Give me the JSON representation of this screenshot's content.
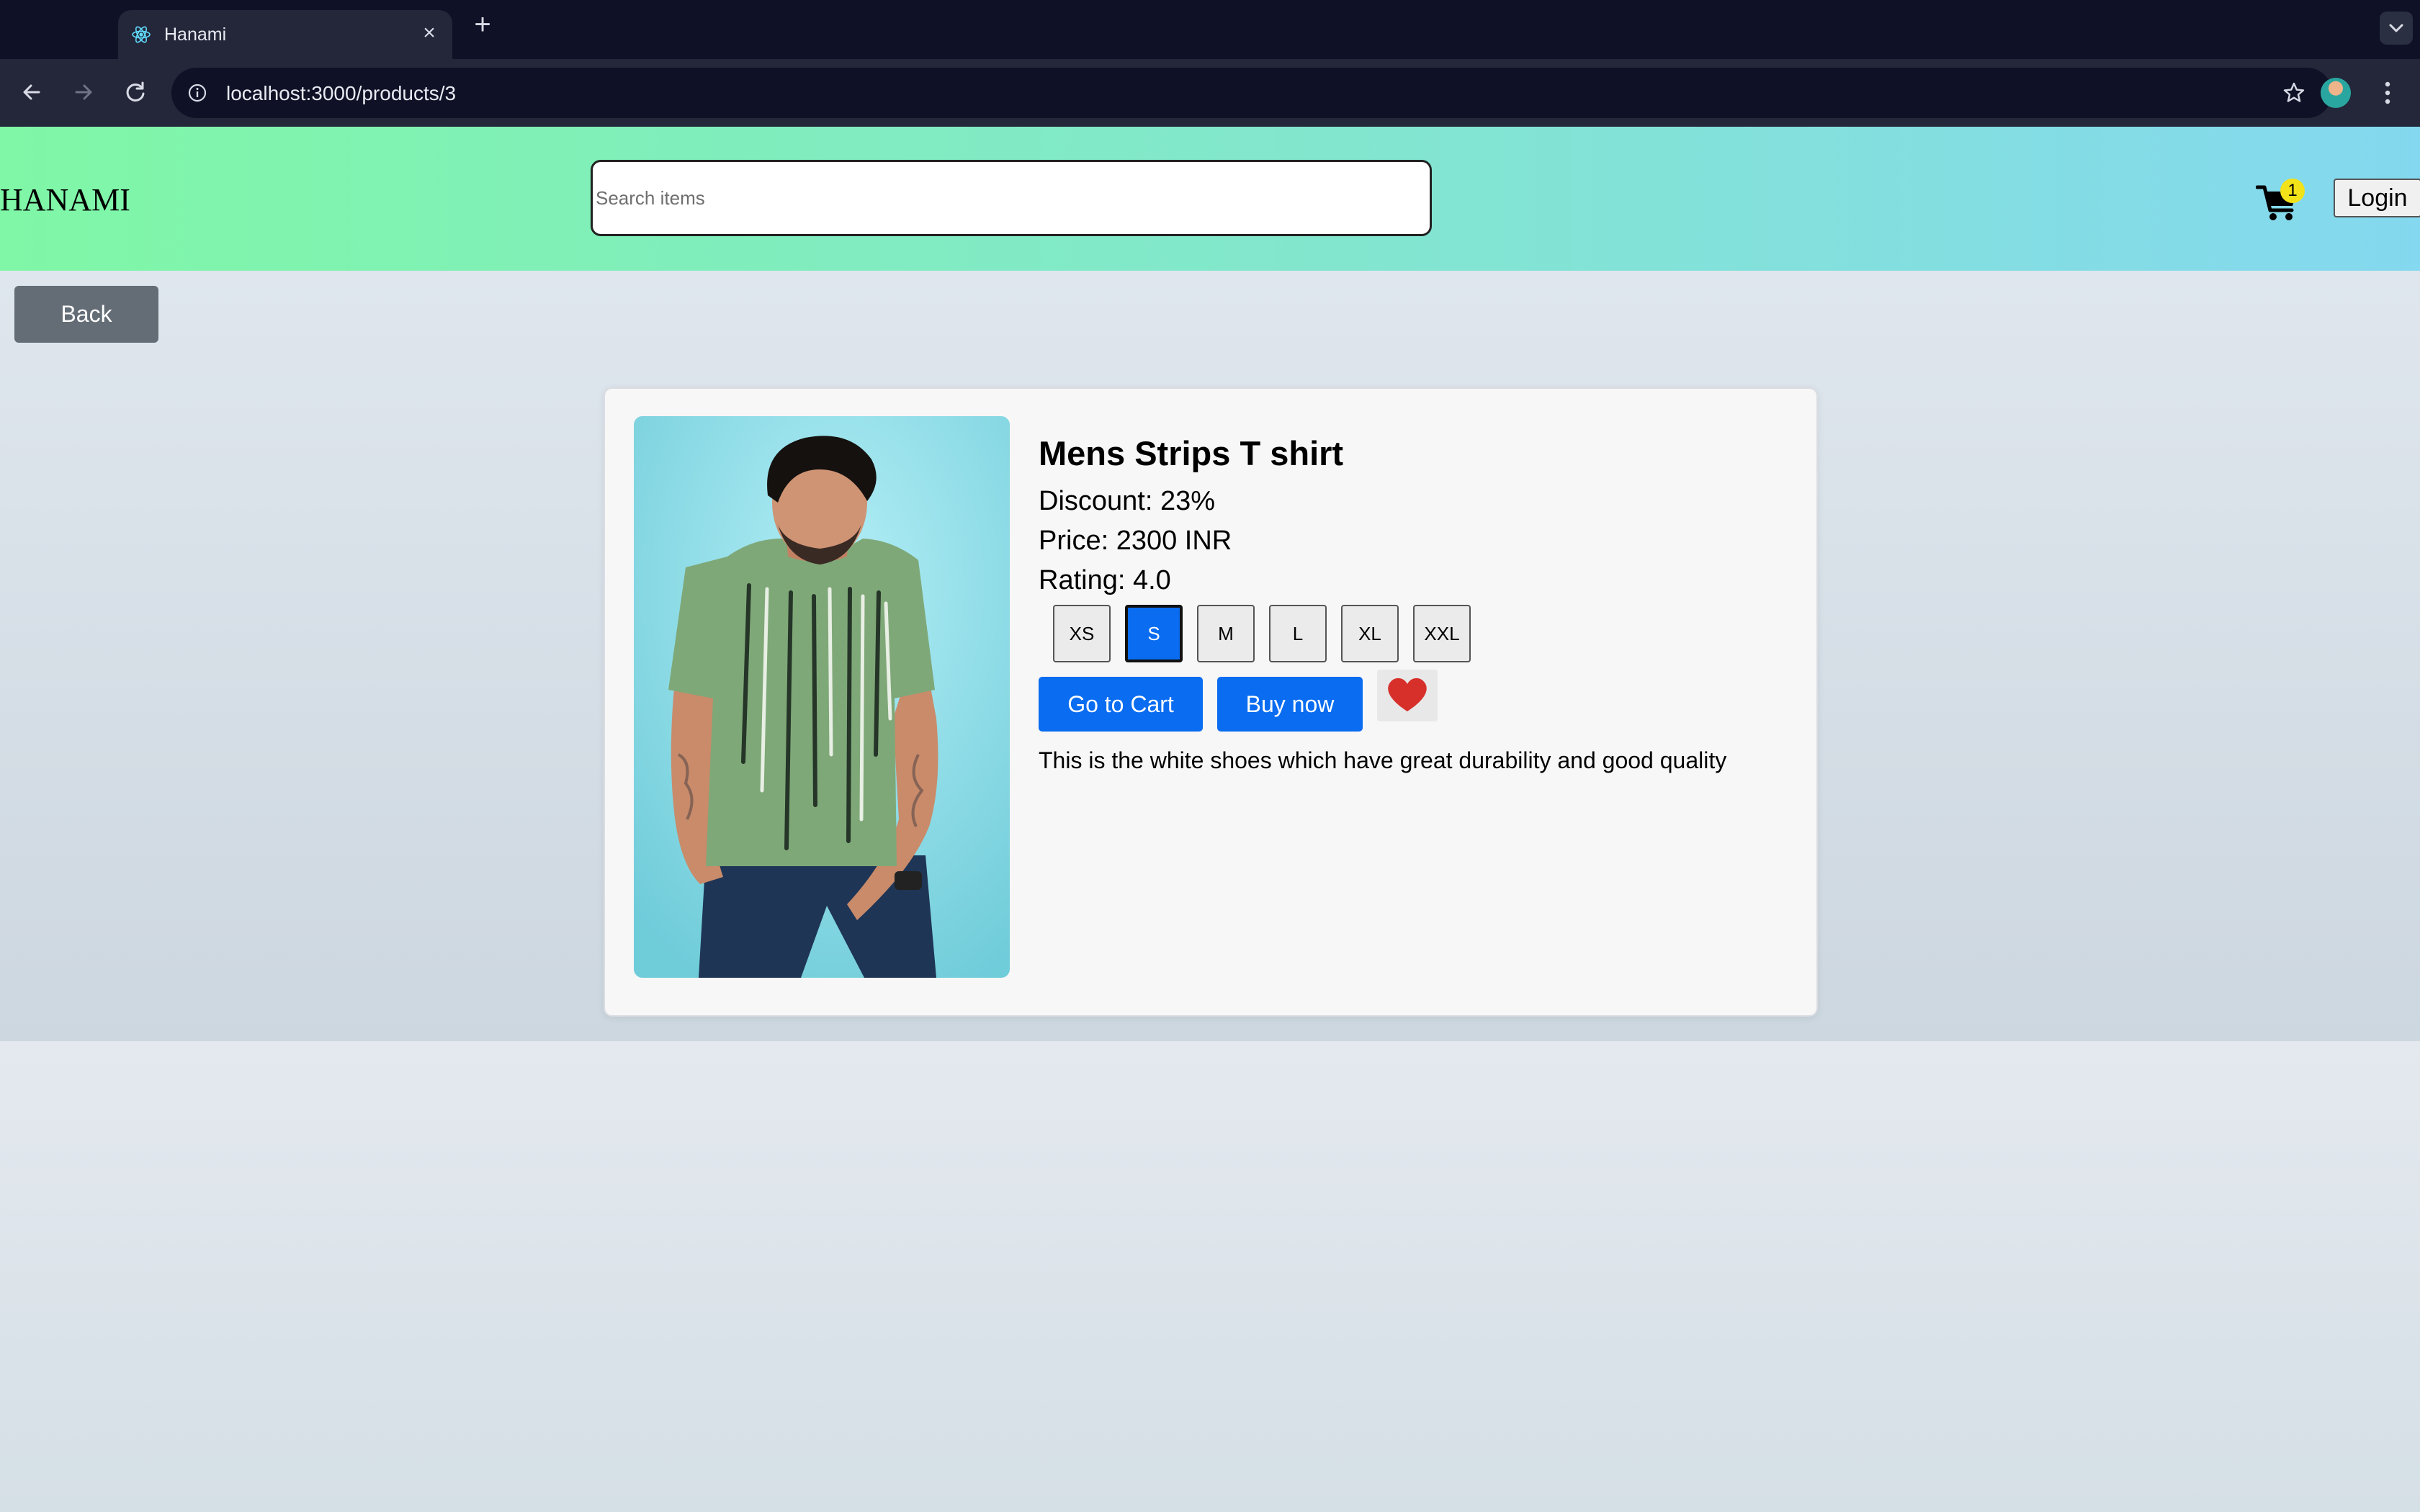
{
  "browser": {
    "tab_title": "Hanami",
    "new_tab_symbol": "+",
    "close_symbol": "×",
    "url": "localhost:3000/products/3"
  },
  "header": {
    "brand": "HANAMI",
    "search_placeholder": "Search items",
    "cart_count": "1",
    "login_label": "Login",
    "gradient_start": "#7ff7a6",
    "gradient_end": "#84d8ef"
  },
  "nav": {
    "back_label": "Back"
  },
  "product": {
    "title": "Mens Strips T shirt",
    "discount_text": "Discount: 23%",
    "price_text": "Price: 2300 INR",
    "rating_text": "Rating: 4.0",
    "sizes": [
      "XS",
      "S",
      "M",
      "L",
      "XL",
      "XXL"
    ],
    "selected_size": "S",
    "go_to_cart_label": "Go to Cart",
    "buy_now_label": "Buy now",
    "description": "This is the white shoes which have great durability and good quality"
  },
  "colors": {
    "accent": "#0a6cf0",
    "heart": "#d7302a",
    "back_button": "#646d76"
  }
}
